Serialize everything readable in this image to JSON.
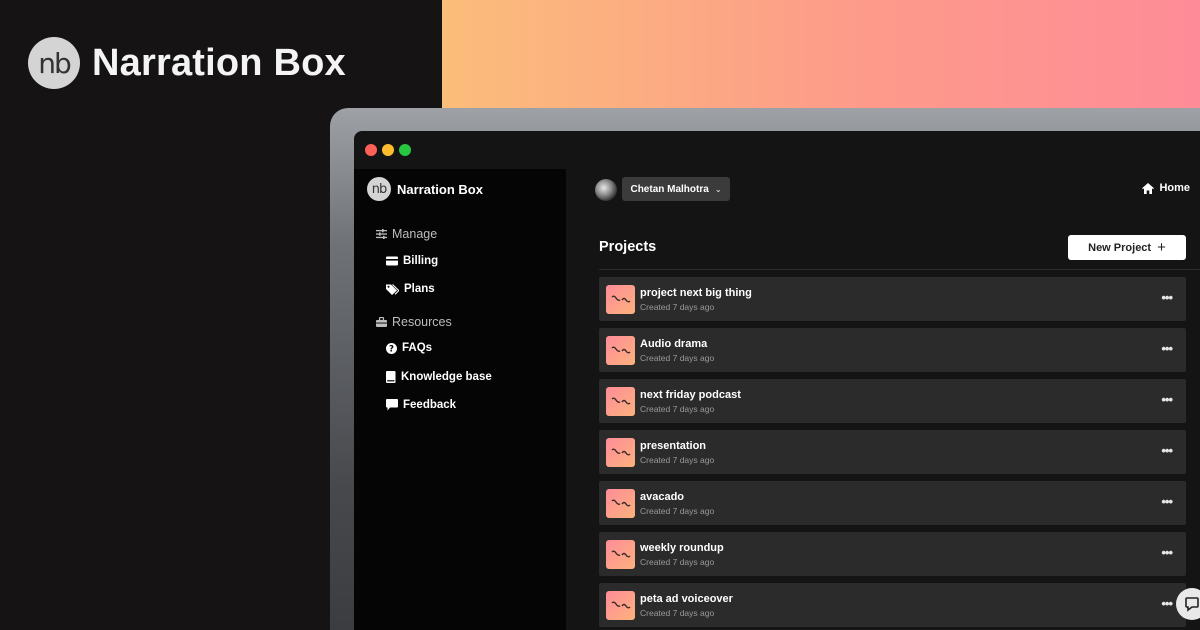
{
  "hero": {
    "logo_text": "nb",
    "brand_name": "Narration Box"
  },
  "window": {
    "controls": [
      "red",
      "yellow",
      "green"
    ]
  },
  "sidebar": {
    "logo_text": "nb",
    "brand_name": "Narration Box",
    "sections": [
      {
        "label": "Manage",
        "icon": "sliders-icon",
        "items": [
          {
            "label": "Billing",
            "icon": "credit-card-icon"
          },
          {
            "label": "Plans",
            "icon": "tags-icon"
          }
        ]
      },
      {
        "label": "Resources",
        "icon": "toolbox-icon",
        "items": [
          {
            "label": "FAQs",
            "icon": "question-circle-icon"
          },
          {
            "label": "Knowledge base",
            "icon": "book-icon"
          },
          {
            "label": "Feedback",
            "icon": "comment-icon"
          }
        ]
      }
    ]
  },
  "topbar": {
    "user_name": "Chetan Malhotra",
    "home_label": "Home"
  },
  "main": {
    "title": "Projects",
    "new_project_label": "New Project",
    "projects": [
      {
        "name": "project next big thing",
        "meta": "Created 7 days ago"
      },
      {
        "name": "Audio drama",
        "meta": "Created 7 days ago"
      },
      {
        "name": "next friday podcast",
        "meta": "Created 7 days ago"
      },
      {
        "name": "presentation",
        "meta": "Created 7 days ago"
      },
      {
        "name": "avacado",
        "meta": "Created 7 days ago"
      },
      {
        "name": "weekly roundup",
        "meta": "Created 7 days ago"
      },
      {
        "name": "peta ad voiceover",
        "meta": "Created 7 days ago"
      }
    ]
  },
  "colors": {
    "gradient_start": "#fbbd7a",
    "gradient_end": "#fe8c98",
    "sidebar_bg": "#050505",
    "row_bg": "#2b2b2b"
  }
}
